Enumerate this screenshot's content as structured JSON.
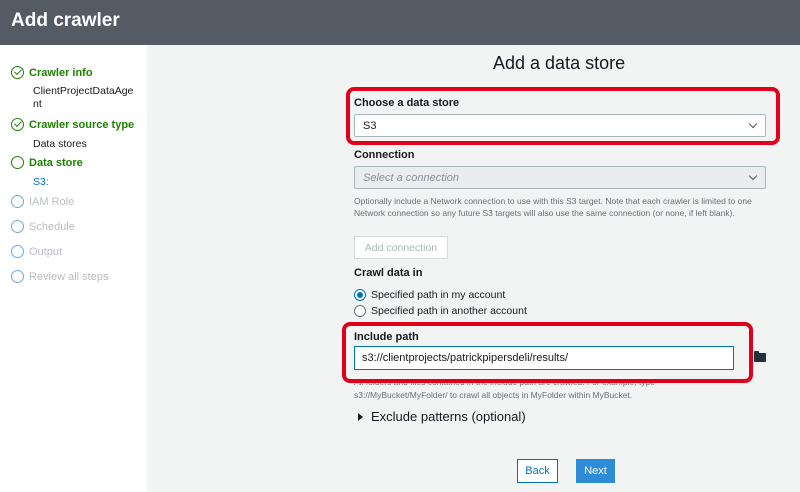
{
  "header": {
    "title": "Add crawler"
  },
  "sidebar": {
    "steps": [
      {
        "label": "Crawler info",
        "sub": "ClientProjectDataAge\nnt"
      },
      {
        "label": "Crawler source type",
        "sub": "Data stores"
      },
      {
        "label": "Data store",
        "sub": "S3:"
      },
      {
        "label": "IAM Role"
      },
      {
        "label": "Schedule"
      },
      {
        "label": "Output"
      },
      {
        "label": "Review all steps"
      }
    ]
  },
  "main": {
    "title": "Add a data store",
    "data_store": {
      "label": "Choose a data store",
      "value": "S3"
    },
    "connection": {
      "label": "Connection",
      "placeholder": "Select a connection",
      "help": "Optionally include a Network connection to use with this S3 target. Note that each crawler is limited to one Network connection so any future S3 targets will also use the same connection (or none, if left blank).",
      "add_button": "Add connection"
    },
    "crawl_in": {
      "label": "Crawl data in",
      "options": [
        "Specified path in my account",
        "Specified path in another account"
      ],
      "selected": 0
    },
    "include_path": {
      "label": "Include path",
      "value": "s3://clientprojects/patrickpipersdeli/results/",
      "help_line1": "All folders and files contained in the include path are crawled. For example, type",
      "help_line2": "s3://MyBucket/MyFolder/ to crawl all objects in MyFolder within MyBucket."
    },
    "exclude": {
      "label": "Exclude patterns (optional)"
    },
    "buttons": {
      "back": "Back",
      "next": "Next"
    }
  },
  "colors": {
    "header_bg": "#545b64",
    "accent": "#0073bb",
    "success": "#1d8102",
    "highlight": "#e0001a"
  }
}
